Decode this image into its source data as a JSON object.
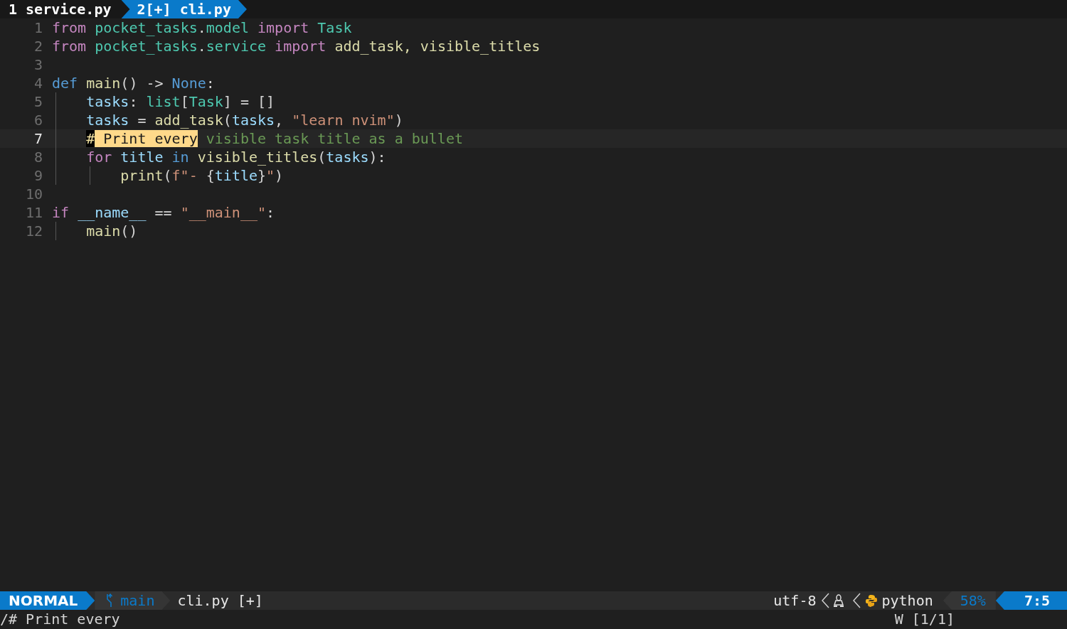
{
  "buffers": [
    {
      "label": "1 service.py",
      "selected": false
    },
    {
      "label": "2[+] cli.py",
      "selected": true
    }
  ],
  "code": [
    {
      "number": "1",
      "current": false,
      "tokens": [
        {
          "text": "from ",
          "kind": "keyword"
        },
        {
          "text": "pocket_tasks",
          "kind": "module"
        },
        {
          "text": ".",
          "kind": "plain"
        },
        {
          "text": "model ",
          "kind": "module"
        },
        {
          "text": "import ",
          "kind": "keyword"
        },
        {
          "text": "Task",
          "kind": "module"
        }
      ]
    },
    {
      "number": "2",
      "current": false,
      "tokens": [
        {
          "text": "from ",
          "kind": "keyword"
        },
        {
          "text": "pocket_tasks",
          "kind": "module"
        },
        {
          "text": ".",
          "kind": "plain"
        },
        {
          "text": "service ",
          "kind": "module"
        },
        {
          "text": "import ",
          "kind": "keyword"
        },
        {
          "text": "add_task, visible_titles",
          "kind": "func"
        }
      ]
    },
    {
      "number": "3",
      "current": false
    },
    {
      "number": "4",
      "current": false,
      "tokens": [
        {
          "text": "def ",
          "kind": "storage"
        },
        {
          "text": "main",
          "kind": "func"
        },
        {
          "text": "() -> ",
          "kind": "plain"
        },
        {
          "text": "None",
          "kind": "storage"
        },
        {
          "text": ":",
          "kind": "plain"
        }
      ],
      "children": [
        {
          "number": "5",
          "current": false,
          "tokens": [
            {
              "text": "tasks",
              "kind": "var"
            },
            {
              "text": ": ",
              "kind": "plain"
            },
            {
              "text": "list",
              "kind": "module"
            },
            {
              "text": "[",
              "kind": "plain"
            },
            {
              "text": "Task",
              "kind": "module"
            },
            {
              "text": "] = []",
              "kind": "plain"
            }
          ]
        },
        {
          "number": "6",
          "current": false,
          "tokens": [
            {
              "text": "tasks",
              "kind": "var"
            },
            {
              "text": " = ",
              "kind": "plain"
            },
            {
              "text": "add_task",
              "kind": "func"
            },
            {
              "text": "(",
              "kind": "plain"
            },
            {
              "text": "tasks",
              "kind": "var"
            },
            {
              "text": ", ",
              "kind": "plain"
            },
            {
              "text": "\"learn nvim\"",
              "kind": "string"
            },
            {
              "text": ")",
              "kind": "plain"
            }
          ]
        },
        {
          "number": "7",
          "current": true,
          "tokens": [
            {
              "text": "#",
              "kind": "cursor"
            },
            {
              "text": " Print every",
              "kind": "match"
            },
            {
              "text": " visible task title as a bullet",
              "kind": "comment"
            }
          ]
        },
        {
          "number": "8",
          "current": false,
          "tokens": [
            {
              "text": "for ",
              "kind": "keyword"
            },
            {
              "text": "title ",
              "kind": "var"
            },
            {
              "text": "in ",
              "kind": "storage"
            },
            {
              "text": "visible_titles",
              "kind": "func"
            },
            {
              "text": "(",
              "kind": "plain"
            },
            {
              "text": "tasks",
              "kind": "var"
            },
            {
              "text": "):",
              "kind": "plain"
            }
          ],
          "children": [
            {
              "number": "9",
              "current": false,
              "tokens": [
                {
                  "text": "print",
                  "kind": "func"
                },
                {
                  "text": "(",
                  "kind": "plain"
                },
                {
                  "text": "f\"- ",
                  "kind": "string"
                },
                {
                  "text": "{",
                  "kind": "plain"
                },
                {
                  "text": "title",
                  "kind": "var"
                },
                {
                  "text": "}",
                  "kind": "plain"
                },
                {
                  "text": "\"",
                  "kind": "string"
                },
                {
                  "text": ")",
                  "kind": "plain"
                }
              ]
            }
          ]
        }
      ]
    },
    {
      "number": "10",
      "current": false
    },
    {
      "number": "11",
      "current": false,
      "tokens": [
        {
          "text": "if ",
          "kind": "keyword"
        },
        {
          "text": "__name__",
          "kind": "var"
        },
        {
          "text": " == ",
          "kind": "plain"
        },
        {
          "text": "\"__main__\"",
          "kind": "string"
        },
        {
          "text": ":",
          "kind": "plain"
        }
      ],
      "children": [
        {
          "number": "12",
          "current": false,
          "tokens": [
            {
              "text": "main",
              "kind": "func"
            },
            {
              "text": "()",
              "kind": "plain"
            }
          ]
        }
      ]
    }
  ],
  "status_bar": {
    "mode": "NORMAL",
    "branch": "main",
    "file": "cli.py [+]",
    "encoding": "utf-8",
    "filetype": "python",
    "percent": "58%",
    "position": "7:5"
  },
  "command_line": {
    "text": "/# Print every",
    "search_count": "W [1/1]"
  }
}
